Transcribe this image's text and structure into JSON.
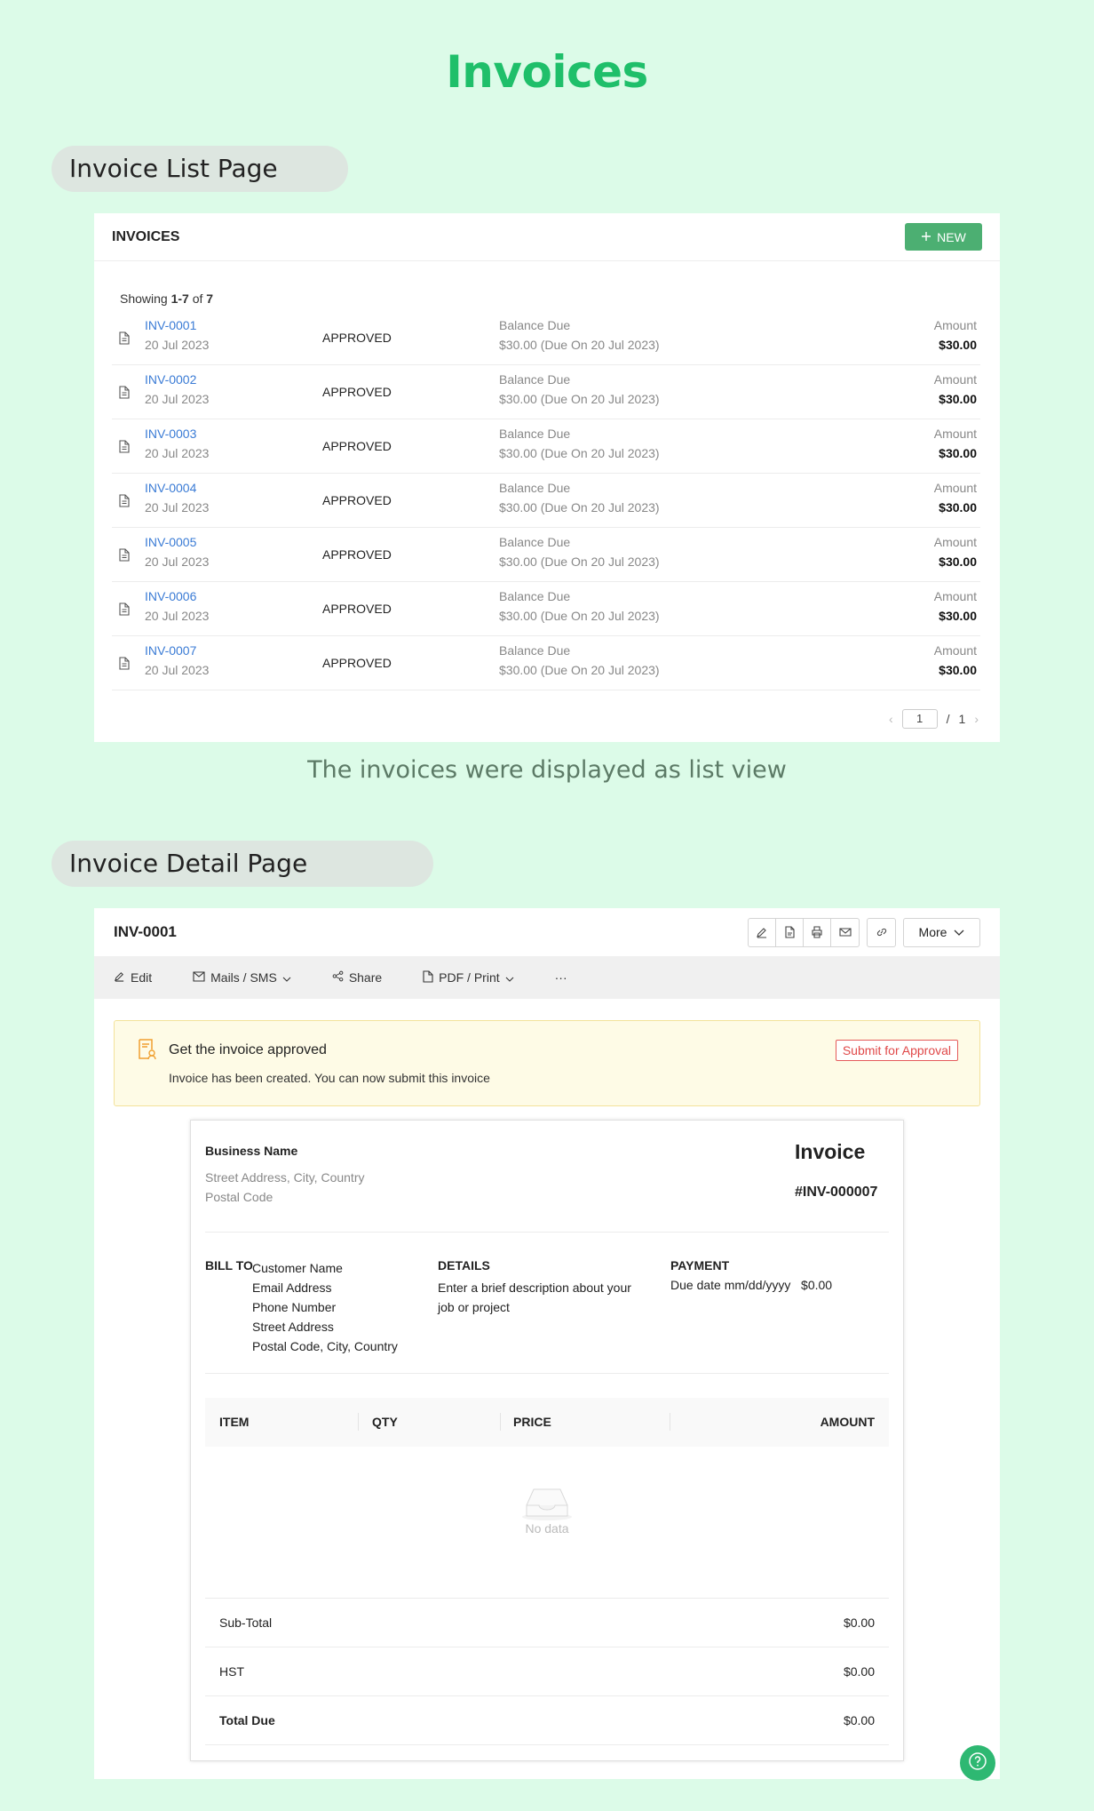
{
  "page": {
    "title": "Invoices"
  },
  "sections": {
    "list_label": "Invoice List Page",
    "list_caption": "The invoices were displayed as list view",
    "detail_label": "Invoice Detail Page"
  },
  "list": {
    "title": "INVOICES",
    "new_button": "NEW",
    "showing_prefix": "Showing ",
    "showing_range": "1-7",
    "showing_of": " of ",
    "showing_total": "7",
    "balance_label": "Balance Due",
    "amount_label": "Amount",
    "rows": [
      {
        "id": "INV-0001",
        "date": "20 Jul 2023",
        "status": "APPROVED",
        "balance": "$30.00 (Due On 20 Jul 2023)",
        "amount": "$30.00"
      },
      {
        "id": "INV-0002",
        "date": "20 Jul 2023",
        "status": "APPROVED",
        "balance": "$30.00 (Due On 20 Jul 2023)",
        "amount": "$30.00"
      },
      {
        "id": "INV-0003",
        "date": "20 Jul 2023",
        "status": "APPROVED",
        "balance": "$30.00 (Due On 20 Jul 2023)",
        "amount": "$30.00"
      },
      {
        "id": "INV-0004",
        "date": "20 Jul 2023",
        "status": "APPROVED",
        "balance": "$30.00 (Due On 20 Jul 2023)",
        "amount": "$30.00"
      },
      {
        "id": "INV-0005",
        "date": "20 Jul 2023",
        "status": "APPROVED",
        "balance": "$30.00 (Due On 20 Jul 2023)",
        "amount": "$30.00"
      },
      {
        "id": "INV-0006",
        "date": "20 Jul 2023",
        "status": "APPROVED",
        "balance": "$30.00 (Due On 20 Jul 2023)",
        "amount": "$30.00"
      },
      {
        "id": "INV-0007",
        "date": "20 Jul 2023",
        "status": "APPROVED",
        "balance": "$30.00 (Due On 20 Jul 2023)",
        "amount": "$30.00"
      }
    ],
    "pager": {
      "current": "1",
      "sep": "/",
      "total": "1"
    }
  },
  "detail": {
    "title": "INV-0001",
    "more_button": "More",
    "toolbar": {
      "edit": "Edit",
      "mails": "Mails / SMS",
      "share": "Share",
      "pdf": "PDF / Print",
      "overflow": "···"
    },
    "alert": {
      "title": "Get the invoice approved",
      "message": "Invoice has been created. You can now submit this invoice",
      "button": "Submit for Approval"
    },
    "invoice": {
      "business_name": "Business Name",
      "address": "Street Address, City, Country",
      "postal": "Postal Code",
      "heading": "Invoice",
      "number": "#INV-000007",
      "bill_to_label": "BILL TO",
      "bill_to_lines": [
        "Customer Name",
        "Email Address",
        "Phone Number",
        "Street Address",
        "Postal Code, City, Country"
      ],
      "details_label": "DETAILS",
      "details_text": "Enter a brief description about your job or project",
      "payment_label": "PAYMENT",
      "payment_text": "Due date mm/dd/yyyy   $0.00",
      "columns": [
        "ITEM",
        "QTY",
        "PRICE",
        "AMOUNT"
      ],
      "empty_text": "No data",
      "totals": [
        {
          "label": "Sub-Total",
          "value": "$0.00"
        },
        {
          "label": "HST",
          "value": "$0.00"
        },
        {
          "label": "Total Due",
          "value": "$0.00"
        }
      ]
    }
  },
  "colors": {
    "background": "#dcfbe8",
    "brand_green": "#1fbf6a",
    "button_green": "#4caf72",
    "link_blue": "#3a7bd5",
    "alert_red": "#e04848"
  }
}
